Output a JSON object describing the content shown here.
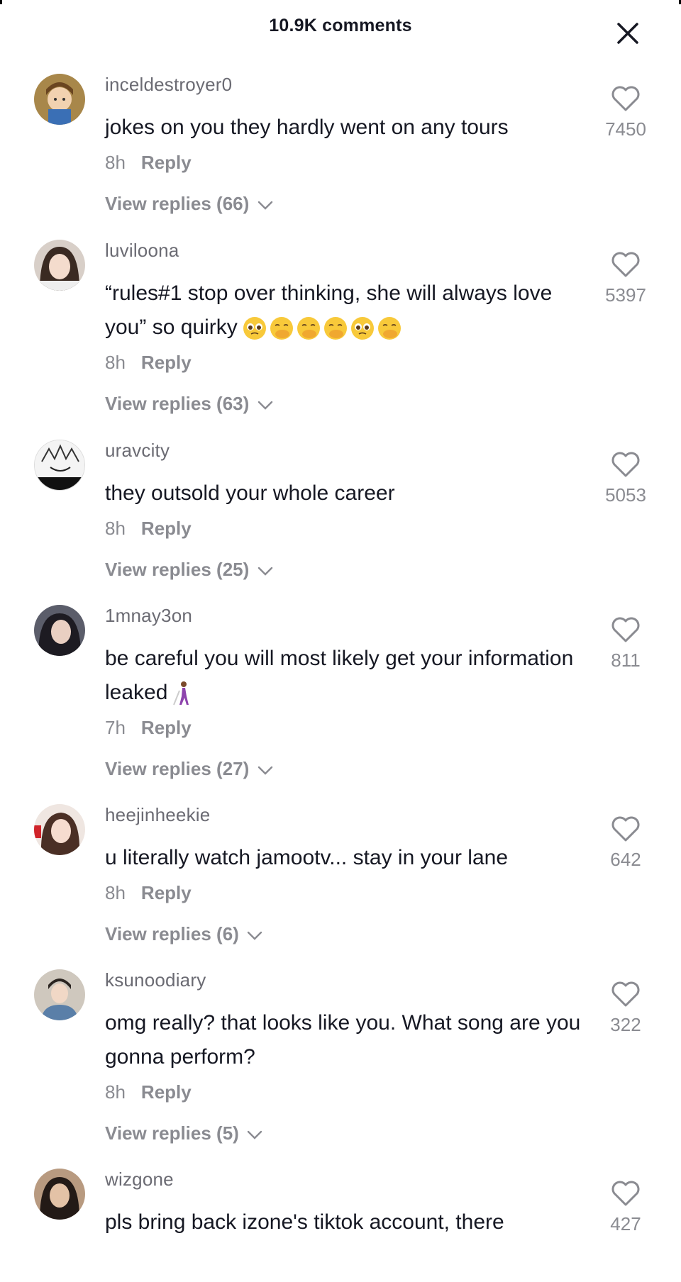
{
  "header": {
    "title": "10.9K comments"
  },
  "comments": [
    {
      "username": "inceldestroyer0",
      "text": "jokes on you they hardly went on any tours",
      "time": "8h",
      "reply_label": "Reply",
      "view_replies": "View replies (66)",
      "likes": "7450"
    },
    {
      "username": "luviloona",
      "text": "“rules#1 stop over thinking, she will always love you” so quirky",
      "emojis": [
        "pleading-face",
        "face-with-hand-over-mouth",
        "face-with-hand-over-mouth",
        "face-with-hand-over-mouth",
        "pleading-face",
        "face-with-hand-over-mouth"
      ],
      "time": "8h",
      "reply_label": "Reply",
      "view_replies": "View replies (63)",
      "likes": "5397"
    },
    {
      "username": "uravcity",
      "text": "they outsold your whole career",
      "time": "8h",
      "reply_label": "Reply",
      "view_replies": "View replies (25)",
      "likes": "5053"
    },
    {
      "username": "1mnay3on",
      "text": "be careful you will most likely get your information leaked",
      "emojis": [
        "person-with-white-cane"
      ],
      "time": "7h",
      "reply_label": "Reply",
      "view_replies": "View replies (27)",
      "likes": "811"
    },
    {
      "username": "heejinheekie",
      "text": "u literally watch jamootv... stay in your lane",
      "time": "8h",
      "reply_label": "Reply",
      "view_replies": "View replies (6)",
      "likes": "642"
    },
    {
      "username": "ksunoodiary",
      "text": "omg really? that looks like you. What song are you gonna perform?",
      "time": "8h",
      "reply_label": "Reply",
      "view_replies": "View replies (5)",
      "likes": "322"
    },
    {
      "username": "wizgone",
      "text": "pls bring back izone's tiktok account, there",
      "likes": "427"
    }
  ],
  "colors": {
    "text": "#161823",
    "muted": "#8a8b91",
    "username": "#6b6b73"
  }
}
